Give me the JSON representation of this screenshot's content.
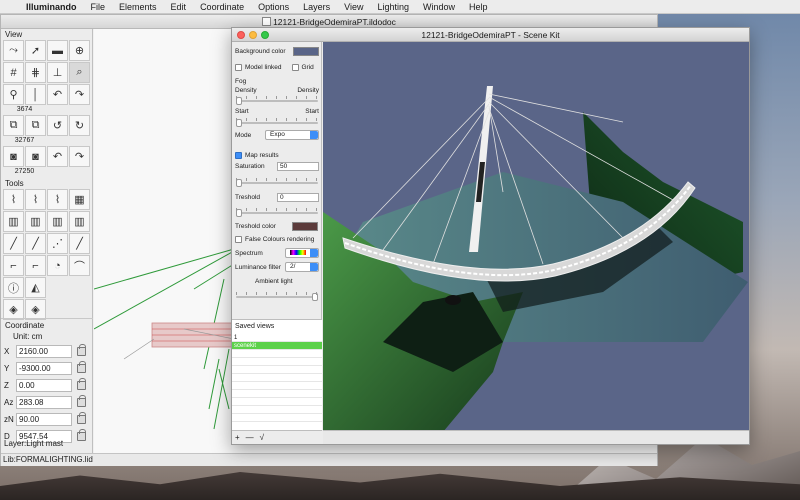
{
  "menubar": {
    "app_name": "Illuminando",
    "menus": [
      "File",
      "Elements",
      "Edit",
      "Coordinate",
      "Options",
      "Layers",
      "View",
      "Lighting",
      "Window",
      "Help"
    ]
  },
  "doc_window": {
    "title": "12121-BridgeOdemiraPT.ildodoc",
    "palette": {
      "view_label": "View",
      "view_numbers": [
        "3674",
        "32767",
        "27250"
      ],
      "tools_label": "Tools"
    },
    "coordinate": {
      "title": "Coordinate",
      "unit": "Unit: cm",
      "rows": [
        {
          "label": "X",
          "value": "2160.00"
        },
        {
          "label": "Y",
          "value": "-9300.00"
        },
        {
          "label": "Z",
          "value": "0.00"
        },
        {
          "label": "Az",
          "value": "283.08"
        },
        {
          "label": "zN",
          "value": "90.00"
        },
        {
          "label": "D",
          "value": "9547.54"
        }
      ],
      "layer": "Layer:Light mast"
    },
    "status": "Lib:FORMALIGHTING.lid"
  },
  "scene_kit": {
    "title": "12121-BridgeOdemiraPT - Scene Kit",
    "background_color_label": "Background color",
    "background_color": "#5a6588",
    "model_linked_label": "Model linked",
    "grid_label": "Grid",
    "fog_label": "Fog",
    "density_label": "Density",
    "density_right": "Density",
    "start_label": "Start",
    "start_right": "Start",
    "mode_label": "Mode",
    "mode_value": "Expo",
    "map_results_label": "Map results",
    "saturation_label": "Saturation",
    "saturation_value": "50",
    "treshold_label": "Treshold",
    "treshold_value": "0",
    "treshold_color_label": "Treshold color",
    "treshold_color": "#5b3a3a",
    "false_colours_label": "False Colours rendering",
    "spectrum_label": "Spectrum",
    "luminance_filter_label": "Luminance filter",
    "luminance_filter_value": "2/",
    "ambient_light_label": "Ambient light",
    "saved_views_label": "Saved views",
    "saved_views": [
      "1",
      "scenekit"
    ],
    "add_label": "+",
    "remove_label": "—",
    "apply_label": "√"
  }
}
